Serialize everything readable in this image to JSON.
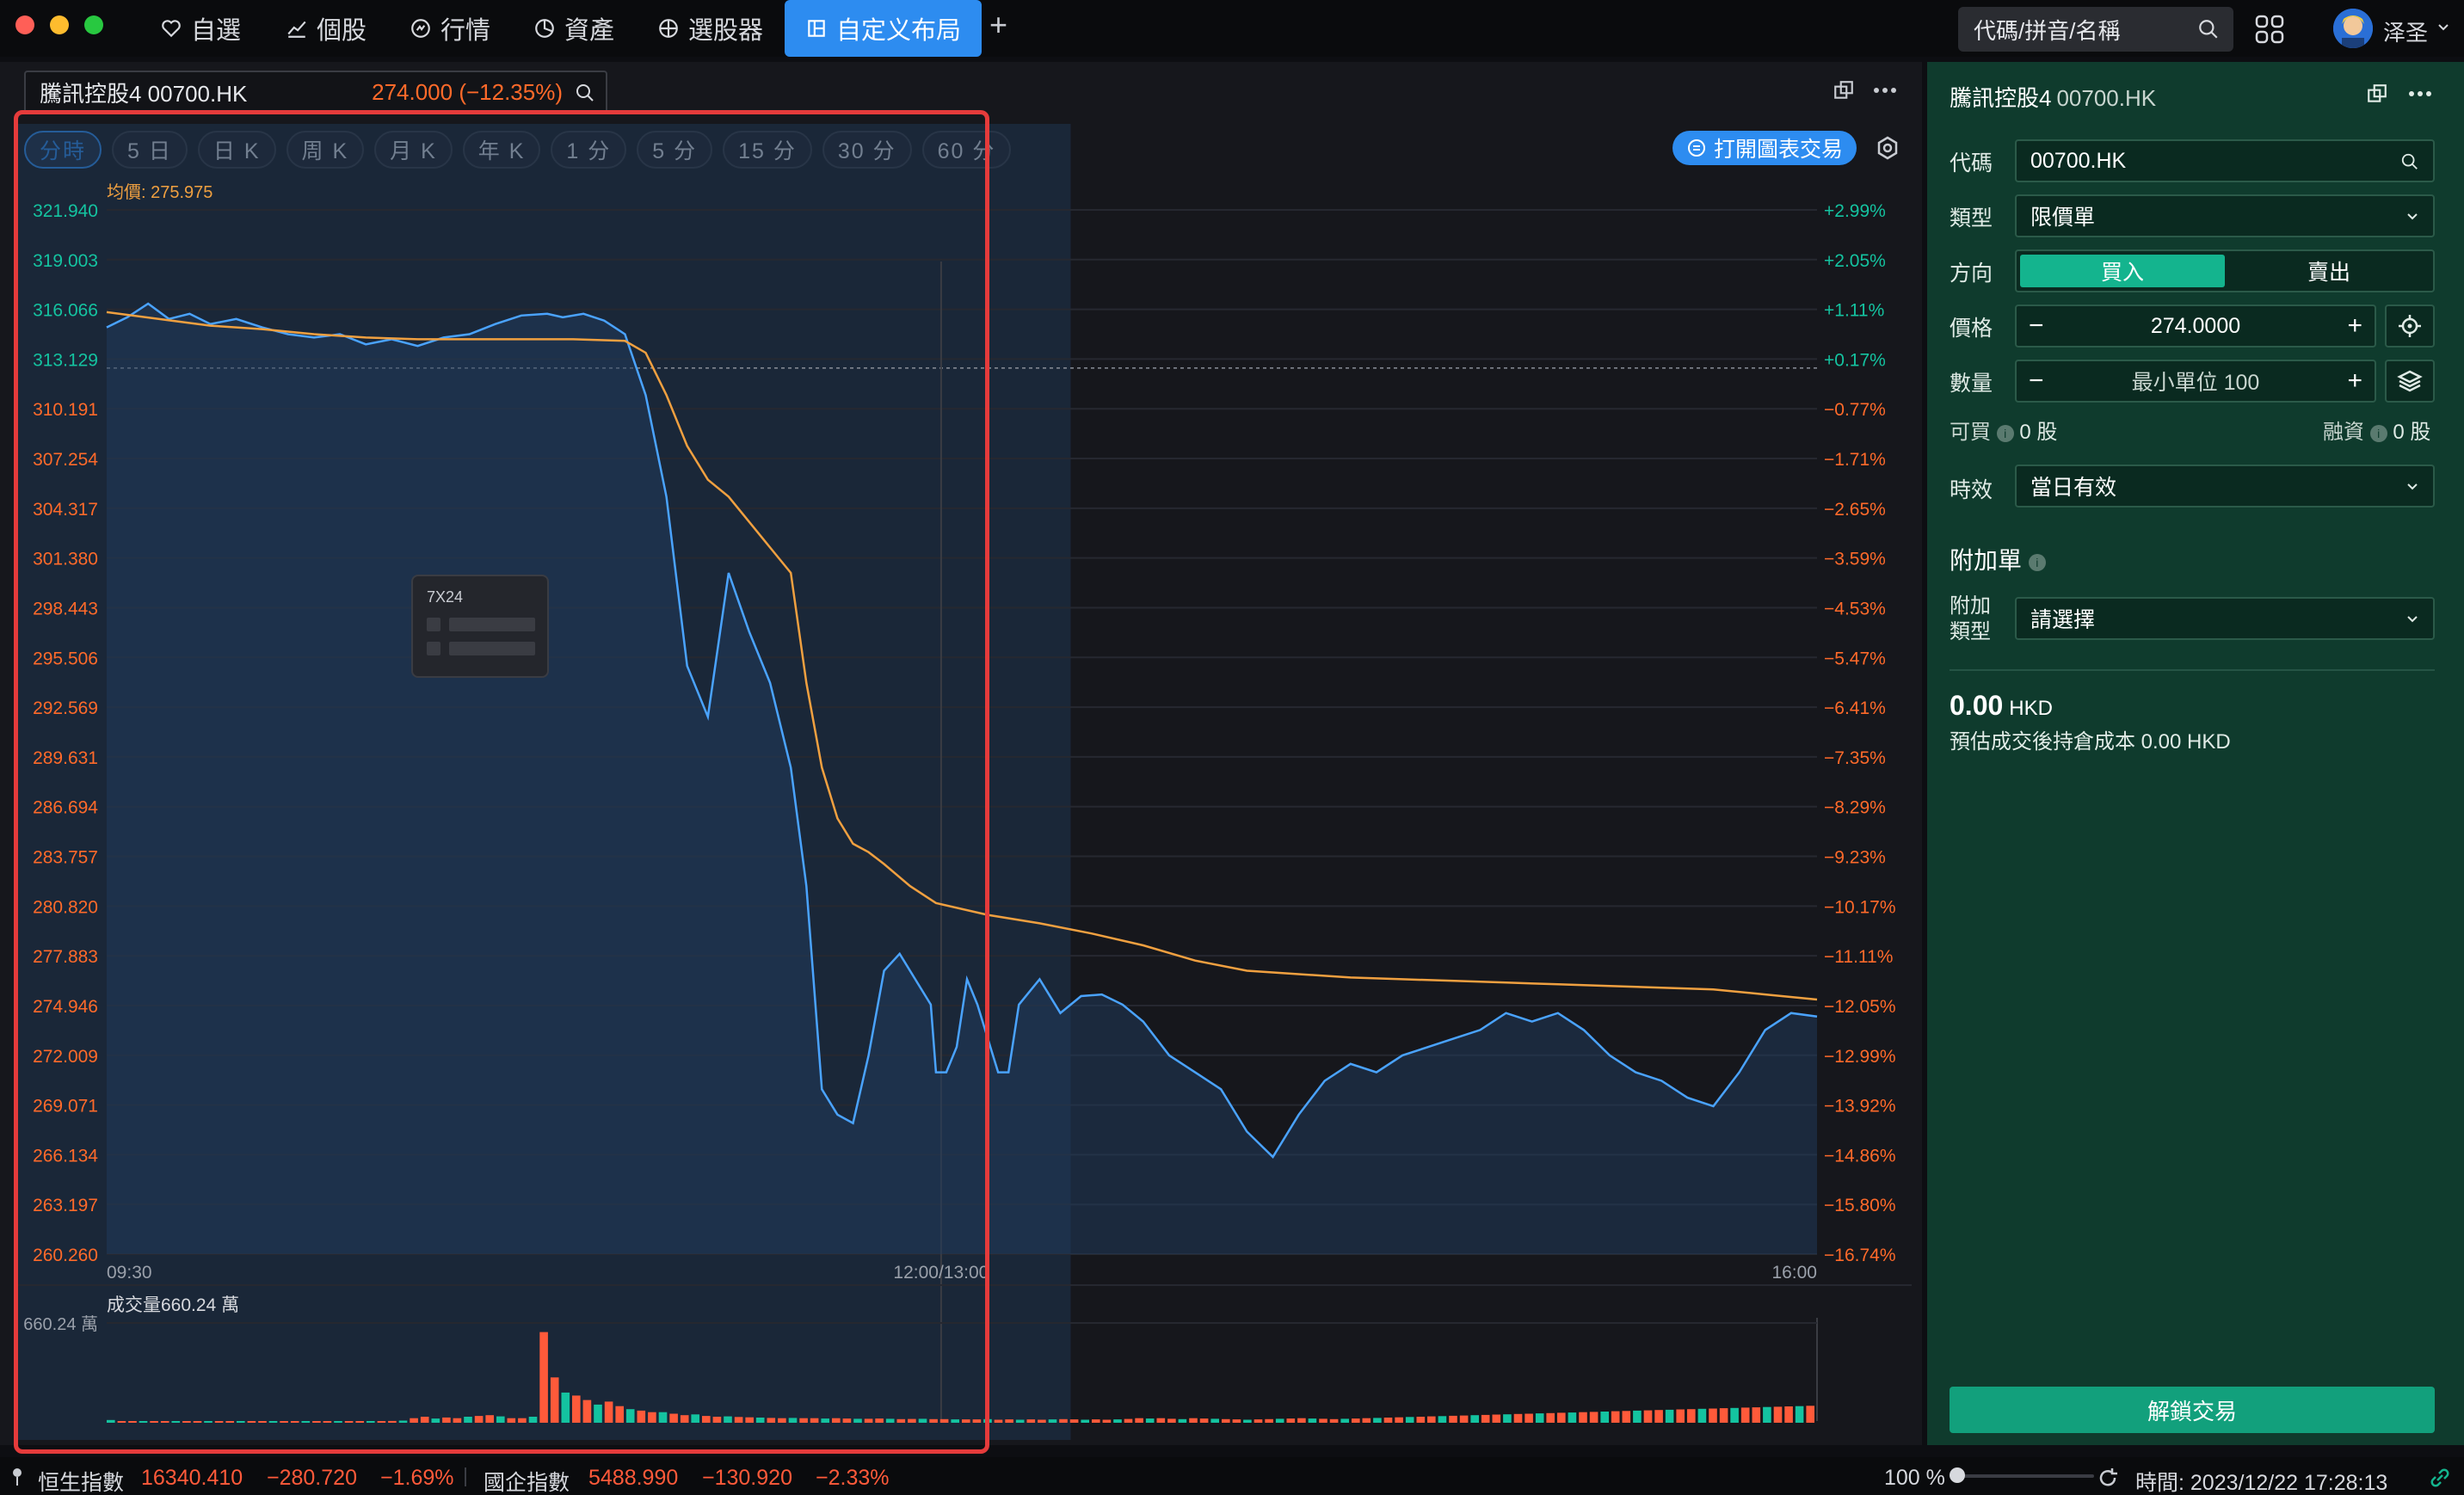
{
  "window": {
    "traffic_colors": [
      "#ff5f57",
      "#febc2e",
      "#28c840"
    ]
  },
  "nav": {
    "items": [
      {
        "label": "自選",
        "icon": "heart-icon"
      },
      {
        "label": "個股",
        "icon": "line-chart-icon"
      },
      {
        "label": "行情",
        "icon": "market-icon"
      },
      {
        "label": "資產",
        "icon": "pie-icon"
      },
      {
        "label": "選股器",
        "icon": "crosshair-icon"
      },
      {
        "label": "自定义布局",
        "icon": "layout-icon",
        "active": true
      }
    ],
    "add_tab": "+"
  },
  "search": {
    "placeholder": "代碼/拼音/名稱"
  },
  "user": {
    "name": "泽圣"
  },
  "stock": {
    "name": "騰訊控股4 00700.HK",
    "price_change": "274.000 (−12.35%)"
  },
  "periods": [
    "分時",
    "5 日",
    "日 K",
    "周 K",
    "月 K",
    "年 K",
    "1 分",
    "5 分",
    "15 分",
    "30 分",
    "60 分"
  ],
  "open_chart_trade": "打開圖表交易",
  "tooltip_title": "7X24",
  "chart_data": {
    "type": "line",
    "avg_label": "均價: 275.975",
    "y_ticks_left": [
      "321.940",
      "319.003",
      "316.066",
      "313.129",
      "310.191",
      "307.254",
      "304.317",
      "301.380",
      "298.443",
      "295.506",
      "292.569",
      "289.631",
      "286.694",
      "283.757",
      "280.820",
      "277.883",
      "274.946",
      "272.009",
      "269.071",
      "266.134",
      "263.197",
      "260.260"
    ],
    "y_ticks_right": [
      "+2.99%",
      "+2.05%",
      "+1.11%",
      "+0.17%",
      "−0.77%",
      "−1.71%",
      "−2.65%",
      "−3.59%",
      "−4.53%",
      "−5.47%",
      "−6.41%",
      "−7.35%",
      "−8.29%",
      "−9.23%",
      "−10.17%",
      "−11.11%",
      "−12.05%",
      "−12.99%",
      "−13.92%",
      "−14.86%",
      "−15.80%",
      "−16.74%"
    ],
    "x_ticks": [
      "09:30",
      "12:00/13:00",
      "16:00"
    ],
    "ylim": [
      260.26,
      321.94
    ],
    "prev_close": 312.6,
    "series": [
      {
        "name": "price",
        "color": "#4aa3ff",
        "x": [
          0,
          4,
          8,
          12,
          16,
          20,
          25,
          30,
          35,
          40,
          45,
          50,
          55,
          60,
          65,
          70,
          75,
          80,
          85,
          88,
          92,
          96,
          100,
          104,
          108,
          112,
          116,
          120,
          124,
          128,
          132,
          135,
          138,
          141,
          144,
          147,
          150,
          153,
          156,
          159,
          160,
          162,
          164,
          166,
          168,
          170,
          172,
          174,
          176,
          180,
          184,
          188,
          192,
          196,
          200,
          205,
          210,
          215,
          220,
          225,
          230,
          235,
          240,
          245,
          250,
          255,
          260,
          265,
          270,
          275,
          280,
          285,
          290,
          295,
          300,
          305,
          310,
          315,
          320,
          325,
          330
        ],
        "values": [
          315.0,
          315.6,
          316.4,
          315.5,
          315.8,
          315.2,
          315.5,
          315.0,
          314.6,
          314.4,
          314.6,
          314.0,
          314.3,
          313.9,
          314.4,
          314.6,
          315.2,
          315.7,
          315.8,
          315.6,
          315.8,
          315.4,
          314.6,
          311.0,
          305.0,
          295.0,
          292.0,
          300.5,
          297.0,
          294.0,
          289.0,
          282.0,
          270.0,
          268.5,
          268.0,
          272.0,
          277.0,
          278.0,
          276.5,
          275.0,
          271.0,
          271.0,
          272.5,
          276.5,
          275.0,
          273.0,
          271.0,
          271.0,
          275.0,
          276.5,
          274.5,
          275.5,
          275.6,
          275.0,
          274.0,
          272.0,
          271.0,
          270.0,
          267.5,
          266.0,
          268.5,
          270.5,
          271.5,
          271.0,
          272.0,
          272.5,
          273.0,
          273.5,
          274.5,
          274.0,
          274.5,
          273.5,
          272.0,
          271.0,
          270.5,
          269.5,
          269.0,
          271.0,
          273.5,
          274.5,
          274.3
        ]
      },
      {
        "name": "avg",
        "color": "#f0a040",
        "x": [
          0,
          10,
          20,
          30,
          40,
          50,
          60,
          70,
          80,
          90,
          100,
          104,
          108,
          112,
          116,
          120,
          124,
          128,
          132,
          135,
          138,
          141,
          144,
          147,
          150,
          155,
          160,
          170,
          180,
          190,
          200,
          210,
          220,
          230,
          240,
          250,
          260,
          270,
          280,
          290,
          300,
          310,
          320,
          330
        ],
        "values": [
          315.9,
          315.5,
          315.1,
          314.9,
          314.6,
          314.4,
          314.3,
          314.3,
          314.3,
          314.3,
          314.2,
          313.5,
          311.0,
          308.0,
          306.0,
          305.0,
          303.5,
          302.0,
          300.5,
          294.0,
          289.0,
          286.0,
          284.5,
          284.0,
          283.3,
          282.0,
          281.0,
          280.3,
          279.8,
          279.2,
          278.5,
          277.6,
          277.0,
          276.8,
          276.6,
          276.5,
          276.4,
          276.3,
          276.2,
          276.1,
          276.0,
          275.9,
          275.6,
          275.3
        ]
      }
    ],
    "volume_label": "成交量660.24 萬",
    "volume_max_label": "660.24 萬",
    "volume_max": 660.24,
    "volume_values": [
      18,
      8,
      6,
      6,
      6,
      5,
      5,
      6,
      5,
      5,
      5,
      6,
      5,
      5,
      5,
      5,
      6,
      6,
      6,
      7,
      7,
      7,
      8,
      8,
      9,
      10,
      12,
      14,
      30,
      40,
      28,
      35,
      30,
      40,
      45,
      50,
      42,
      30,
      30,
      40,
      600,
      300,
      200,
      180,
      150,
      120,
      140,
      110,
      90,
      80,
      70,
      70,
      60,
      50,
      55,
      45,
      40,
      42,
      38,
      36,
      34,
      32,
      30,
      32,
      30,
      30,
      28,
      30,
      28,
      26,
      26,
      28,
      26,
      24,
      25,
      26,
      24,
      24,
      22,
      22,
      22,
      24,
      20,
      22,
      20,
      22,
      20,
      22,
      24,
      22,
      20,
      22,
      20,
      22,
      25,
      30,
      28,
      30,
      26,
      24,
      30,
      28,
      26,
      24,
      22,
      20,
      22,
      24,
      26,
      28,
      30,
      28,
      26,
      24,
      26,
      28,
      30,
      32,
      34,
      36,
      38,
      40,
      42,
      44,
      46,
      48,
      50,
      52,
      54,
      56,
      58,
      60,
      62,
      64,
      66,
      68,
      70,
      72,
      74,
      76,
      78,
      80,
      82,
      84,
      86,
      88,
      90,
      92,
      94,
      96,
      98,
      100,
      102,
      104,
      106,
      108,
      110,
      112
    ]
  },
  "trade": {
    "title": "騰訊控股4",
    "code": "00700.HK",
    "labels": {
      "code": "代碼",
      "type": "類型",
      "direction": "方向",
      "price": "價格",
      "qty": "數量",
      "tif": "時效",
      "addon_type_1": "附加",
      "addon_type_2": "類型"
    },
    "code_value": "00700.HK",
    "type_value": "限價單",
    "buy": "買入",
    "sell": "賣出",
    "price_value": "274.0000",
    "qty_placeholder": "最小單位 100",
    "can_buy_label": "可買",
    "can_buy_value": "0 股",
    "margin_label": "融資",
    "margin_value": "0 股",
    "tif_value": "當日有效",
    "addon_title": "附加單",
    "addon_value": "請選擇",
    "amount": "0.00",
    "currency": "HKD",
    "est_cost": "預估成交後持倉成本 0.00 HKD",
    "unlock": "解鎖交易"
  },
  "status": {
    "hsi_name": "恒生指數",
    "hsi_value": "16340.410",
    "hsi_change": "−280.720",
    "hsi_pct": "−1.69%",
    "hscei_name": "國企指數",
    "hscei_value": "5488.990",
    "hscei_change": "−130.920",
    "hscei_pct": "−2.33%",
    "zoom": "100 %",
    "time": "時間: 2023/12/22 17:28:13"
  }
}
